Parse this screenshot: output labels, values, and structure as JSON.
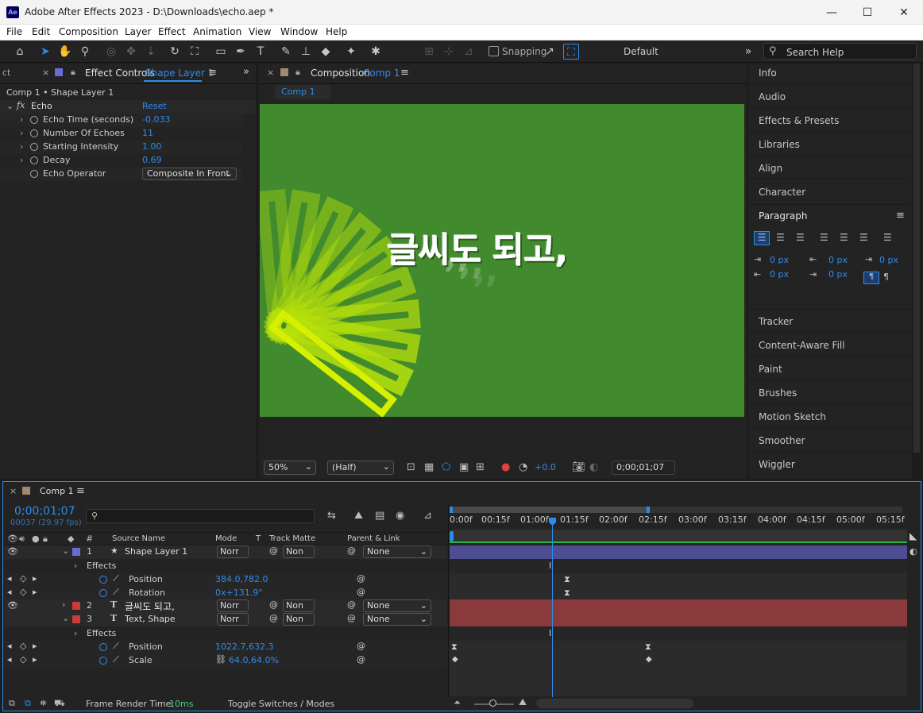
{
  "window": {
    "title": "Adobe After Effects 2023 - D:\\Downloads\\echo.aep *",
    "logo": "Ae"
  },
  "menu": [
    "File",
    "Edit",
    "Composition",
    "Layer",
    "Effect",
    "Animation",
    "View",
    "Window",
    "Help"
  ],
  "toolbar": {
    "snapping_label": "Snapping",
    "workspace": "Default",
    "search_placeholder": "Search Help"
  },
  "effect_controls": {
    "tab_prefix": "ct",
    "tab_label": "Effect Controls",
    "tab_layer": "Shape Layer 1",
    "breadcrumb": "Comp 1 • Shape Layer 1",
    "effect_name": "Echo",
    "reset": "Reset",
    "props": [
      {
        "name": "Echo Time (seconds)",
        "value": "-0.033"
      },
      {
        "name": "Number Of Echoes",
        "value": "11"
      },
      {
        "name": "Starting Intensity",
        "value": "1.00"
      },
      {
        "name": "Decay",
        "value": "0.69"
      },
      {
        "name": "Echo Operator",
        "value": "Composite In Front"
      }
    ]
  },
  "composition": {
    "tab_label": "Composition",
    "tab_comp": "Comp 1",
    "subtab": "Comp 1",
    "canvas_color": "#428a2e",
    "text": "글씨도 되고,",
    "zoom": "50%",
    "resolution": "(Half)",
    "exposure": "+0.0",
    "timecode": "0;00;01;07"
  },
  "right_panel": {
    "items_top": [
      "Info",
      "Audio",
      "Effects & Presets",
      "Libraries",
      "Align",
      "Character"
    ],
    "paragraph": {
      "title": "Paragraph",
      "indents": [
        "0 px",
        "0 px",
        "0 px",
        "0 px",
        "0 px"
      ]
    },
    "items_bottom": [
      "Tracker",
      "Content-Aware Fill",
      "Paint",
      "Brushes",
      "Motion Sketch",
      "Smoother",
      "Wiggler"
    ]
  },
  "timeline": {
    "tab": "Comp 1",
    "timecode": "0;00;01;07",
    "frames": "00037 (29.97 fps)",
    "columns": {
      "source": "Source Name",
      "mode": "Mode",
      "t": "T",
      "matte": "Track Matte",
      "parent": "Parent & Link"
    },
    "ruler": [
      "0:00f",
      "00:15f",
      "01:00f",
      "01:15f",
      "02:00f",
      "02:15f",
      "03:00f",
      "03:15f",
      "04:00f",
      "04:15f",
      "05:00f",
      "05:15f"
    ],
    "layers": [
      {
        "num": "1",
        "name": "Shape Layer 1",
        "mode": "Norr",
        "matte": "Non",
        "parent": "None",
        "color": "#6b6bd6"
      },
      {
        "effects": "Effects",
        "pos_label": "Position",
        "pos_val": "384.0,782.0",
        "rot_label": "Rotation",
        "rot_val": "0x+131.9°"
      },
      {
        "num": "2",
        "name": "글씨도 되고,",
        "mode": "Norr",
        "matte": "Non",
        "parent": "None",
        "color": "#cc3b3b"
      },
      {
        "num": "3",
        "name": "Text, Shape",
        "mode": "Norr",
        "matte": "Non",
        "parent": "None",
        "color": "#cc3b3b"
      },
      {
        "effects": "Effects",
        "pos_label": "Position",
        "pos_val": "1022.7,632.3",
        "scale_label": "Scale",
        "scale_val": "64.0,64.0%"
      }
    ],
    "footer": {
      "render_label": "Frame Render Time:",
      "render_val": "10ms",
      "toggle": "Toggle Switches / Modes"
    }
  },
  "colors": {
    "accent": "#2d8ceb",
    "shape_bar": "#4d4d94",
    "text_bar": "#8a3a3a",
    "playhead": "#2d8ceb"
  }
}
